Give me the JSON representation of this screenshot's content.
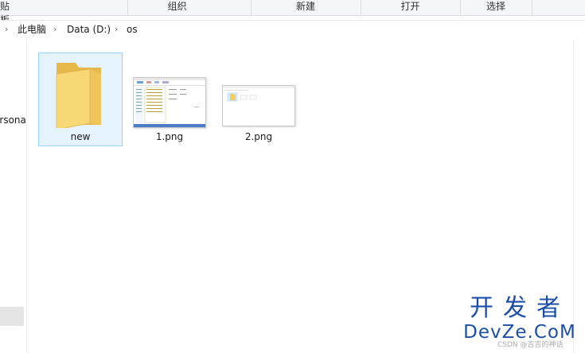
{
  "ribbon": {
    "groups": [
      {
        "label": "贴板"
      },
      {
        "label": "组织"
      },
      {
        "label": "新建"
      },
      {
        "label": "打开"
      },
      {
        "label": "选择"
      }
    ]
  },
  "address": {
    "crumbs": [
      "此电脑",
      "Data (D:)",
      "os"
    ]
  },
  "nav": {
    "partial_item": "ersona"
  },
  "files": [
    {
      "name": "new",
      "type": "folder",
      "selected": true
    },
    {
      "name": "1.png",
      "type": "image",
      "selected": false
    },
    {
      "name": "2.png",
      "type": "image",
      "selected": false
    }
  ],
  "watermark": {
    "cn": "开发者",
    "en": "DevZe.CoM",
    "small": "CSDN @吉吉的神话"
  },
  "colors": {
    "selection_bg": "#e5f3ff",
    "selection_border": "#99d1ff",
    "folder": "#f5cd5b",
    "watermark": "#1d4fa8"
  }
}
